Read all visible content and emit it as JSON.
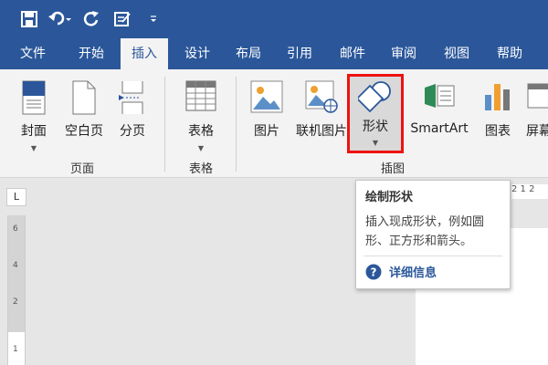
{
  "tabs": [
    {
      "label": "文件"
    },
    {
      "label": "开始"
    },
    {
      "label": "插入"
    },
    {
      "label": "设计"
    },
    {
      "label": "布局"
    },
    {
      "label": "引用"
    },
    {
      "label": "邮件"
    },
    {
      "label": "审阅"
    },
    {
      "label": "视图"
    },
    {
      "label": "帮助"
    }
  ],
  "ribbon": {
    "pages_group": {
      "label": "页面",
      "cover": "封面",
      "blank": "空白页",
      "break": "分页"
    },
    "table_group": {
      "label": "表格",
      "table": "表格"
    },
    "illustrations_group": {
      "label": "插图",
      "picture": "图片",
      "online_picture": "联机图片",
      "shapes": "形状",
      "smartart": "SmartArt",
      "chart": "图表",
      "screenshot": "屏幕"
    }
  },
  "tooltip": {
    "title": "绘制形状",
    "description": "插入现成形状，例如圆形、正方形和箭头。",
    "more": "详细信息"
  },
  "ruler": {
    "corner": "L",
    "ticks": [
      "6",
      "4",
      "2",
      "1"
    ],
    "h_ticks": "2 1 2"
  },
  "colors": {
    "accent": "#2b579a",
    "highlight": "#ee1111",
    "shape_blue": "#2b579a"
  }
}
